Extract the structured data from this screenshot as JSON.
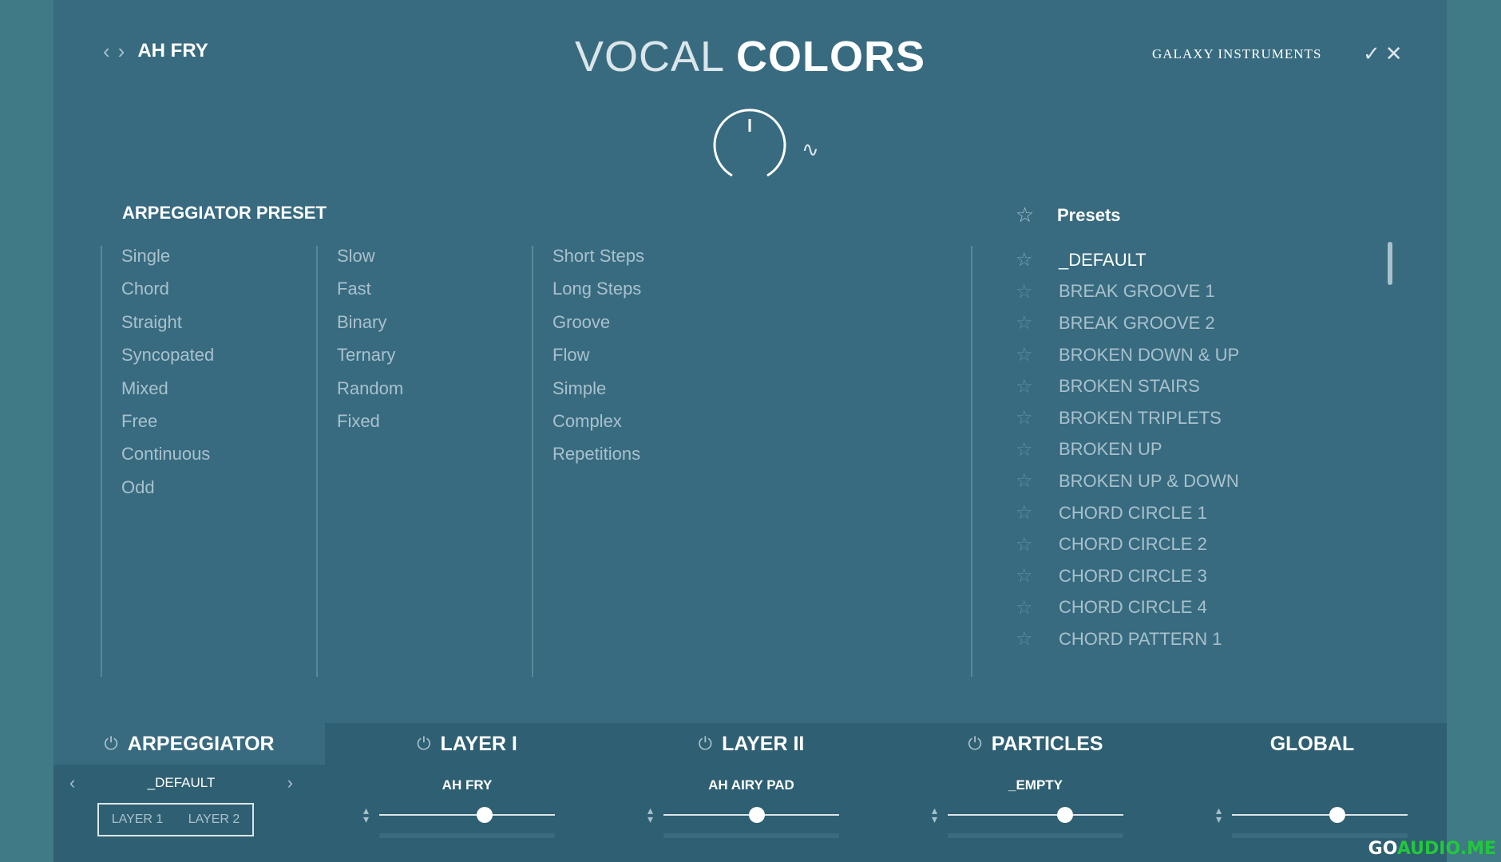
{
  "header": {
    "preset_name": "AH FRY",
    "logo_light": "VOCAL",
    "logo_bold": "COLORS",
    "brand": "GALAXY INSTRUMENTS",
    "icons": [
      "chevron-left-icon",
      "chevron-right-icon",
      "check-icon",
      "close-icon",
      "knob-icon",
      "wave-icon"
    ]
  },
  "arp_preset": {
    "title": "ARPEGGIATOR PRESET",
    "col1": [
      "Single",
      "Chord",
      "Straight",
      "Syncopated",
      "Mixed",
      "Free",
      "Continuous",
      "Odd"
    ],
    "col2": [
      "Slow",
      "Fast",
      "Binary",
      "Ternary",
      "Random",
      "Fixed"
    ],
    "col3": [
      "Short Steps",
      "Long Steps",
      "Groove",
      "Flow",
      "Simple",
      "Complex",
      "Repetitions"
    ]
  },
  "presets": {
    "title": "Presets",
    "items": [
      "_DEFAULT",
      "BREAK GROOVE 1",
      "BREAK GROOVE 2",
      "BROKEN DOWN & UP",
      "BROKEN STAIRS",
      "BROKEN TRIPLETS",
      "BROKEN UP",
      "BROKEN UP & DOWN",
      "CHORD CIRCLE 1",
      "CHORD CIRCLE 2",
      "CHORD CIRCLE 3",
      "CHORD CIRCLE 4",
      "CHORD PATTERN 1"
    ],
    "active_index": 0
  },
  "bottom": {
    "tabs": [
      "ARPEGGIATOR",
      "LAYER I",
      "LAYER II",
      "PARTICLES",
      "GLOBAL"
    ],
    "arp_preset": "_DEFAULT",
    "layer_toggle": [
      "LAYER 1",
      "LAYER 2"
    ],
    "layer1_sample": "AH FRY",
    "layer2_sample": "AH AIRY PAD",
    "particles_sample": "_EMPTY",
    "sliders": [
      0.6,
      0.53,
      0.67,
      0.6
    ]
  },
  "colors": {
    "background": "#386b80",
    "panel_dark": "#2f5f72",
    "accent": "#ffffff",
    "muted_text": "#a9c1cc"
  },
  "watermark": {
    "part1": "GO",
    "part2": "AUDIO.ME"
  }
}
